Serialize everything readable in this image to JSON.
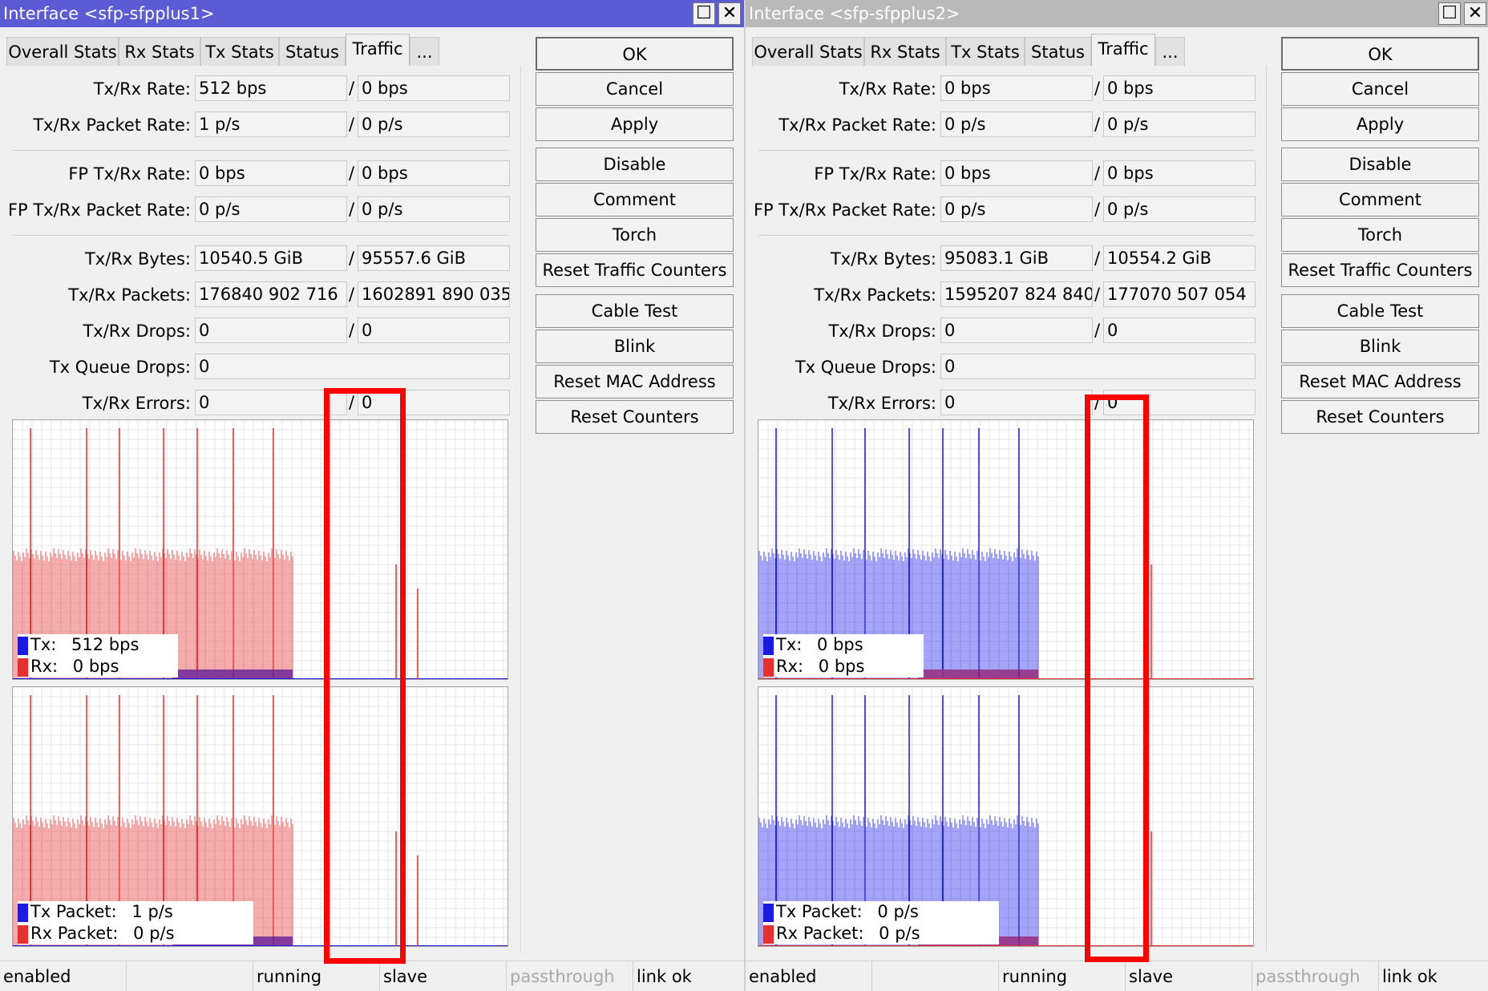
{
  "colors": {
    "tx": "#1a1ae0",
    "rx": "#e53030",
    "tx_fill": "#4a4af0",
    "rx_fill": "#ea5a5a",
    "highlight": "#ff0000",
    "title_active": "#5b5bd6",
    "title_inactive": "#b9b9b9"
  },
  "windows": [
    {
      "title": "Interface <sfp-sfpplus1>",
      "title_state": "active",
      "title_buttons": {
        "maximize": "☐",
        "close": "✕"
      },
      "tabs": [
        "Overall Stats",
        "Rx Stats",
        "Tx Stats",
        "Status",
        "Traffic",
        "..."
      ],
      "active_tab": "Traffic",
      "fields": {
        "rate": {
          "label": "Tx/Rx Rate:",
          "tx": "512 bps",
          "rx": "0 bps"
        },
        "packet_rate": {
          "label": "Tx/Rx Packet Rate:",
          "tx": "1 p/s",
          "rx": "0 p/s"
        },
        "fp_rate": {
          "label": "FP Tx/Rx Rate:",
          "tx": "0 bps",
          "rx": "0 bps"
        },
        "fp_packet_rate": {
          "label": "FP Tx/Rx Packet Rate:",
          "tx": "0 p/s",
          "rx": "0 p/s"
        },
        "bytes": {
          "label": "Tx/Rx Bytes:",
          "tx": "10540.5 GiB",
          "rx": "95557.6 GiB"
        },
        "packets": {
          "label": "Tx/Rx Packets:",
          "tx": "176840 902 716",
          "rx": "1602891 890 035"
        },
        "drops": {
          "label": "Tx/Rx Drops:",
          "tx": "0",
          "rx": "0"
        },
        "queue_drops": {
          "label": "Tx Queue Drops:",
          "value": "0"
        },
        "errors": {
          "label": "Tx/Rx Errors:",
          "tx": "0",
          "rx": "0"
        }
      },
      "slash": "/",
      "graph_bits": {
        "tx_label": "Tx:",
        "tx_value": "512 bps",
        "rx_label": "Rx:",
        "rx_value": "0 bps",
        "dominant": "rx"
      },
      "graph_packets": {
        "tx_label": "Tx Packet:",
        "tx_value": "1 p/s",
        "rx_label": "Rx Packet:",
        "rx_value": "0 p/s",
        "dominant": "rx"
      },
      "buttons": [
        "OK",
        "Cancel",
        "Apply",
        "Disable",
        "Comment",
        "Torch",
        "Reset Traffic Counters",
        "Cable Test",
        "Blink",
        "Reset MAC Address",
        "Reset Counters"
      ],
      "status": [
        "enabled",
        "",
        "running",
        "slave",
        "passthrough",
        "link ok"
      ]
    },
    {
      "title": "Interface <sfp-sfpplus2>",
      "title_state": "inactive",
      "title_buttons": {
        "maximize": "☐",
        "close": "✕"
      },
      "tabs": [
        "Overall Stats",
        "Rx Stats",
        "Tx Stats",
        "Status",
        "Traffic",
        "..."
      ],
      "active_tab": "Traffic",
      "fields": {
        "rate": {
          "label": "Tx/Rx Rate:",
          "tx": "0 bps",
          "rx": "0 bps"
        },
        "packet_rate": {
          "label": "Tx/Rx Packet Rate:",
          "tx": "0 p/s",
          "rx": "0 p/s"
        },
        "fp_rate": {
          "label": "FP Tx/Rx Rate:",
          "tx": "0 bps",
          "rx": "0 bps"
        },
        "fp_packet_rate": {
          "label": "FP Tx/Rx Packet Rate:",
          "tx": "0 p/s",
          "rx": "0 p/s"
        },
        "bytes": {
          "label": "Tx/Rx Bytes:",
          "tx": "95083.1 GiB",
          "rx": "10554.2 GiB"
        },
        "packets": {
          "label": "Tx/Rx Packets:",
          "tx": "1595207 824 840",
          "rx": "177070 507 054"
        },
        "drops": {
          "label": "Tx/Rx Drops:",
          "tx": "0",
          "rx": "0"
        },
        "queue_drops": {
          "label": "Tx Queue Drops:",
          "value": "0"
        },
        "errors": {
          "label": "Tx/Rx Errors:",
          "tx": "0",
          "rx": "0"
        }
      },
      "slash": "/",
      "graph_bits": {
        "tx_label": "Tx:",
        "tx_value": "0 bps",
        "rx_label": "Rx:",
        "rx_value": "0 bps",
        "dominant": "tx"
      },
      "graph_packets": {
        "tx_label": "Tx Packet:",
        "tx_value": "0 p/s",
        "rx_label": "Rx Packet:",
        "rx_value": "0 p/s",
        "dominant": "tx"
      },
      "buttons": [
        "OK",
        "Cancel",
        "Apply",
        "Disable",
        "Comment",
        "Torch",
        "Reset Traffic Counters",
        "Cable Test",
        "Blink",
        "Reset MAC Address",
        "Reset Counters"
      ],
      "status": [
        "enabled",
        "",
        "running",
        "slave",
        "passthrough",
        "link ok"
      ]
    }
  ]
}
